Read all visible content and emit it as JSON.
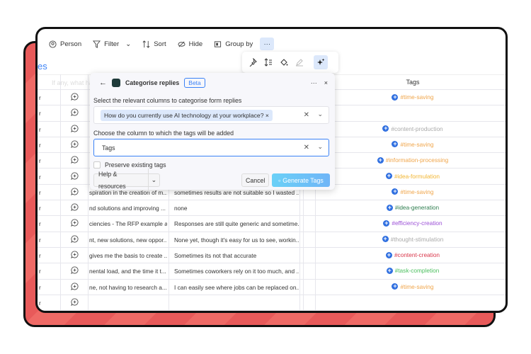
{
  "toolbar": {
    "items": [
      {
        "label": "Person",
        "icon": "person-icon"
      },
      {
        "label": "Filter",
        "icon": "filter-icon"
      },
      {
        "label": "Sort",
        "icon": "sort-icon"
      },
      {
        "label": "Hide",
        "icon": "hide-icon"
      },
      {
        "label": "Group by",
        "icon": "group-by-icon"
      }
    ],
    "more": "···"
  },
  "board_title_fragment": "es",
  "header": {
    "question_fragment": "If any, what have",
    "tags": "Tags"
  },
  "popover": {
    "icons": [
      "pin-icon",
      "row-height-icon",
      "paint-bucket-icon",
      "edit-icon",
      "ai-sparkle-icon"
    ]
  },
  "dialog": {
    "title": "Categorise replies",
    "badge": "Beta",
    "more": "···",
    "close": "×",
    "columns_label": "Select the relevant columns to categorise form replies",
    "selected_column": "How do you currently use AI technology at your workplace?",
    "target_label": "Choose the column to which the tags will be added",
    "target_value": "Tags",
    "preserve_label": "Preserve existing tags",
    "help_label": "Help & resources",
    "cancel_label": "Cancel",
    "generate_label": "Generate Tags"
  },
  "rows": [
    {
      "c0": "r",
      "c1": "",
      "c2": "",
      "tag": "#time-saving",
      "color": "#f0a54a"
    },
    {
      "c0": "r",
      "c1": "",
      "c2": "",
      "tag": "",
      "color": ""
    },
    {
      "c0": "r",
      "c1": "",
      "c2": "",
      "tag": "#content-production",
      "color": "#aaaaaa"
    },
    {
      "c0": "r",
      "c1": "",
      "c2": "",
      "tag": "#time-saving",
      "color": "#f0a54a"
    },
    {
      "c0": "r",
      "c1": "",
      "c2": "",
      "tag": "#information-processing",
      "color": "#f0a54a"
    },
    {
      "c0": "r",
      "c1": "",
      "c2": "",
      "tag": "#idea-formulation",
      "color": "#f2b632"
    },
    {
      "c0": "r",
      "c1": "spiration in the creation of m...",
      "c2": "sometimes results are not suitable so I wasted ...",
      "tag": "#time-saving",
      "color": "#f0a54a"
    },
    {
      "c0": "r",
      "c1": "nd solutions and improving ...",
      "c2": "none",
      "tag": "#idea-generation",
      "color": "#2e7d4f"
    },
    {
      "c0": "r",
      "c1": "ciencies - The RFP example a...",
      "c2": "Responses are still quite generic and sometime...",
      "tag": "#efficiency-creation",
      "color": "#9b4fd6"
    },
    {
      "c0": "r",
      "c1": "nt, new solutions, new oppor...",
      "c2": "None yet, though it's easy for us to see, workin...",
      "tag": "#thought-stimulation",
      "color": "#aaaaaa"
    },
    {
      "c0": "r",
      "c1": "gives me the basis to create ...",
      "c2": "Sometimes its not that accurate",
      "tag": "#content-creation",
      "color": "#d9364a"
    },
    {
      "c0": "r",
      "c1": "nental load, and the time it t...",
      "c2": "Sometimes coworkers rely on it too much, and ...",
      "tag": "#task-completion",
      "color": "#4bbf5e"
    },
    {
      "c0": "r",
      "c1": "ne, not having to research a...",
      "c2": "I can easily see where jobs can be replaced on...",
      "tag": "#time-saving",
      "color": "#f0a54a"
    },
    {
      "c0": "r",
      "c1": "",
      "c2": "",
      "tag": "",
      "color": ""
    }
  ],
  "colors": {
    "accent": "#3b82f6",
    "back_card": "#e85a5a",
    "tag_plus": "#2f6fe0"
  }
}
